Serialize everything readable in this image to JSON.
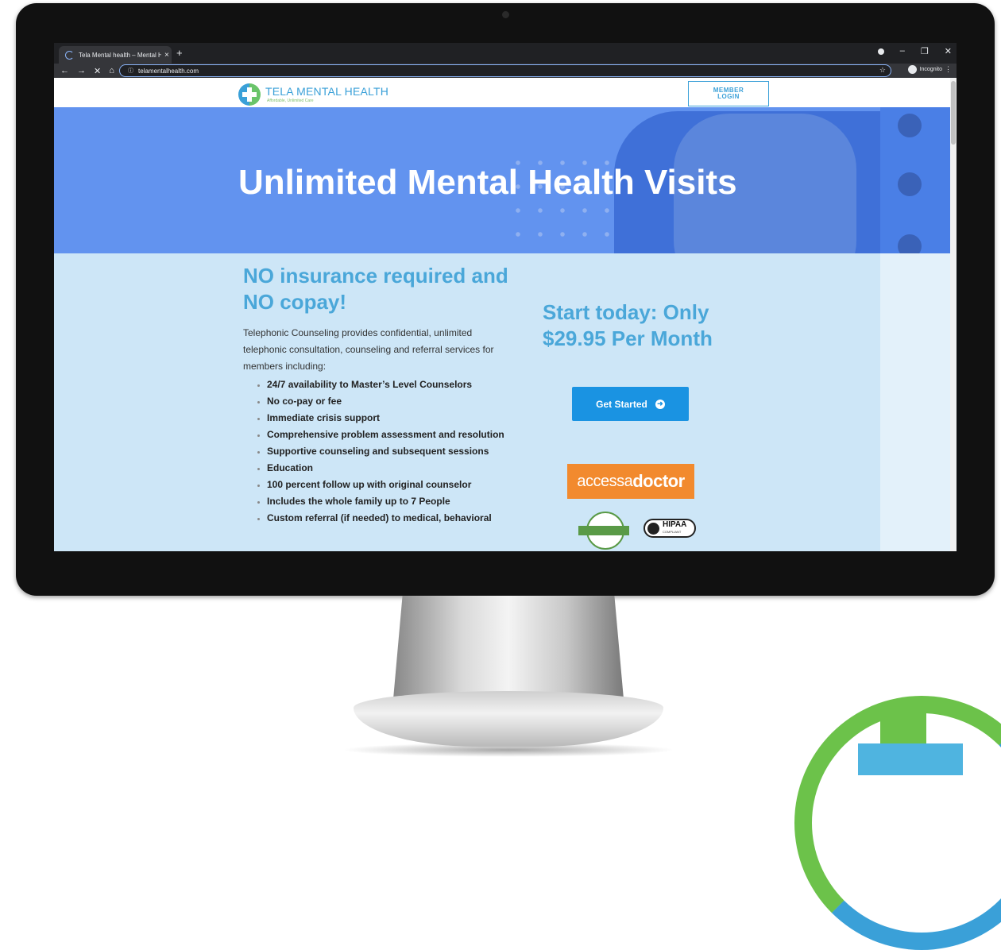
{
  "browser": {
    "tab_title": "Tela Mental health – Mental Hea",
    "tab_close": "×",
    "new_tab": "+",
    "url": "telamentalhealth.com",
    "incognito_label": "Incognito"
  },
  "site": {
    "logo_text": "TELA MENTAL HEALTH",
    "logo_tagline": "Affordable, Unlimited Care",
    "member_login": "MEMBER\nLOGIN"
  },
  "hero": {
    "title": "Unlimited Mental Health Visits"
  },
  "main": {
    "heading": "NO insurance required and NO copay!",
    "description": "Telephonic Counseling provides confidential, unlimited telephonic consultation, counseling and referral services for members including:",
    "features": [
      "24/7 availability to Master’s Level Counselors",
      "No co-pay or fee",
      "Immediate crisis support",
      "Comprehensive problem assessment and resolution",
      "Supportive counseling and subsequent sessions",
      "Education",
      "100 percent follow up with original counselor",
      "Includes the whole family up to 7 People",
      "Custom referral (if needed) to medical, behavioral"
    ]
  },
  "cta": {
    "text": "Start today: Only $29.95 Per Month",
    "button_label": "Get Started"
  },
  "partners": {
    "accessa_light": "accessa",
    "accessa_bold": "doctor",
    "hipaa_label": "HIPAA",
    "hipaa_sub": "COMPLIANT"
  },
  "colors": {
    "hero_bg": "#6293ef",
    "content_bg": "#cde6f7",
    "heading": "#4aa7d9",
    "button": "#1a93e2",
    "accessa": "#f28a2e"
  }
}
